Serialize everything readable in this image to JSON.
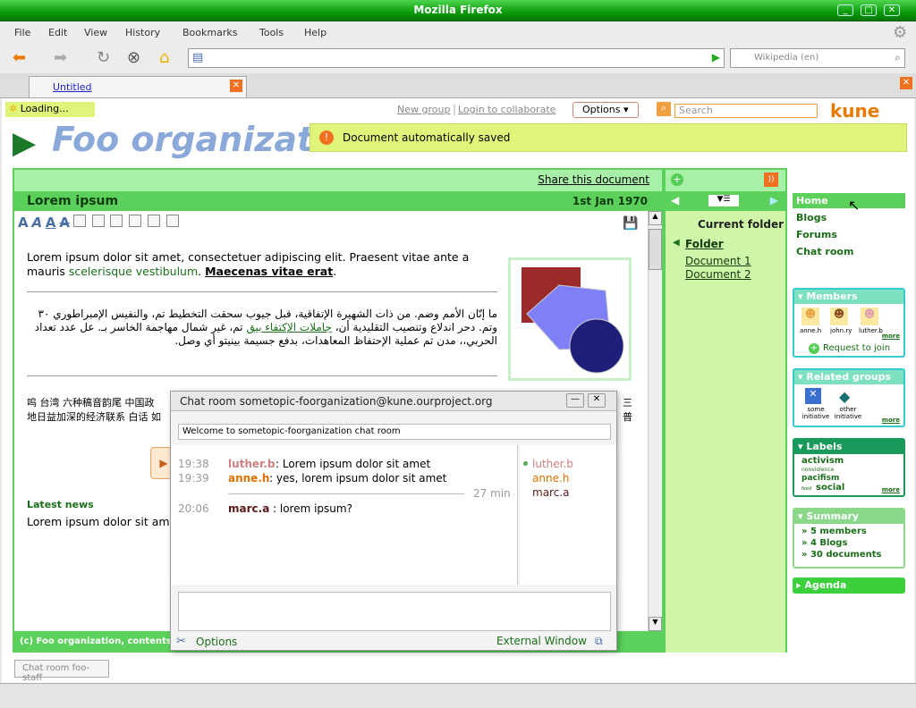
{
  "window": {
    "title": "Mozilla Firefox"
  },
  "menu": [
    "File",
    "Edit",
    "View",
    "History",
    "Bookmarks",
    "Tools",
    "Help"
  ],
  "browser": {
    "search_placeholder": "Wikipedia (en)",
    "tab_title": "Untitled"
  },
  "status": {
    "loading": "Loading..."
  },
  "header": {
    "new_group": "New group",
    "login": "Login to collaborate",
    "options": "Options",
    "search_placeholder": "Search",
    "logo": "kune",
    "notice": "Document automatically saved"
  },
  "org": {
    "name": "Foo organization"
  },
  "doc": {
    "share": "Share this document",
    "title": "Lorem ipsum",
    "date": "1st Jan 1970",
    "p1a": "Lorem ipsum dolor sit amet, consectetuer adipiscing elit. Praesent vitae ante a mauris ",
    "p1b": "scelerisque vestibulum",
    "p1c": "Maecenas vitae erat",
    "arabic1": "ما إنّان الأمم وضم. من ذات الشهيرة الإتفاقية، قبل جيوب سحقت التخطيط تم، والنفيس الإمبراطوري ٣٠",
    "arabic2a": "وتم. دحر اندلاع وتنصيب التقليدية أن، ",
    "arabic2b": "جاملات الإكتفاء بيق",
    "arabic2c": " تم، غير شمال مهاجمة الخاسر بـ. عل عدد تعداد",
    "arabic3": "الحربي،، مدن ثم عملية الإحتفاظ المعاهدات، بدفع جسيمة بينيتو أي وصل.",
    "cjk1": "呜 台湾 六种稿音韵尾 中国政",
    "cjk1end": "三",
    "cjk2": "地日益加深的经济联系 白话 如",
    "cjk2end": "普",
    "latest": "Latest news",
    "p2": "Lorem ipsum dolor sit ame",
    "footer": "(c) Foo organization, contents unde"
  },
  "folder": {
    "title": "Current folder",
    "folder": "Folder",
    "docs": [
      "Document 1",
      "Document 2"
    ]
  },
  "sidebar": {
    "nav": [
      "Home",
      "Blogs",
      "Forums",
      "Chat room"
    ],
    "members": {
      "title": "Members",
      "names": [
        "anne.h",
        "john.ry",
        "luther.b"
      ],
      "more": "more",
      "join": "Request to join"
    },
    "related": {
      "title": "Related groups",
      "items": [
        "some initiative",
        "other initiative"
      ],
      "more": "more"
    },
    "labels": {
      "title": "Labels",
      "tags": [
        "activism",
        "nonviolence",
        "pacifism",
        "feed",
        "social"
      ],
      "more": "more"
    },
    "summary": {
      "title": "Summary",
      "items": [
        "» 5 members",
        "» 4 Blogs",
        "» 30 documents"
      ]
    },
    "agenda": "Agenda"
  },
  "chat": {
    "title": "Chat room sometopic-foorganization@kune.ourproject.org",
    "welcome": "Welcome to sometopic-foorganization chat room",
    "messages": [
      {
        "time": "19:38",
        "user": "luther.b",
        "text": ": Lorem ipsum dolor sit amet"
      },
      {
        "time": "19:39",
        "user": "anne.h",
        "text": ": yes, lorem ipsum dolor sit amet"
      },
      {
        "time": "20:06",
        "user": "marc.a",
        "text": ": lorem ipsum?"
      }
    ],
    "gap": "27 min",
    "users": [
      "luther.b",
      "anne.h",
      "marc.a"
    ],
    "options": "Options",
    "external": "External Window"
  },
  "bottom": {
    "chat_tab": "Chat room foo-staff"
  },
  "colors": {
    "green": "#5bd05b",
    "light_green": "#a8f0a8",
    "brand": "#1a6e1a",
    "notice": "#dff57a"
  }
}
